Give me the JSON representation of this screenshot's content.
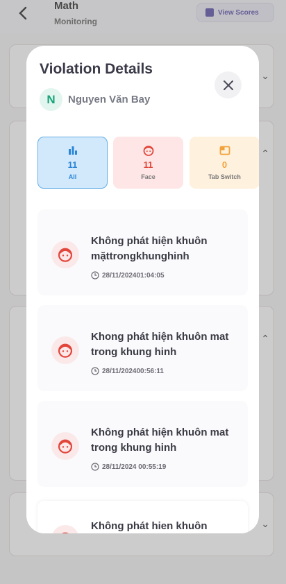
{
  "header": {
    "title": "Math",
    "subtitle": "Monitoring",
    "view_scores": "View Scores"
  },
  "modal": {
    "title": "Violation Details",
    "student_initial": "N",
    "student_name": "Nguyen Văn Bay",
    "tabs": [
      {
        "count": "11",
        "label": "All"
      },
      {
        "count": "11",
        "label": "Face"
      },
      {
        "count": "0",
        "label": "Tab Switch"
      }
    ],
    "violations": [
      {
        "text": "Không phát hiện khuôn mặttrongkhunghinh",
        "time": "28/11/202401:04:05"
      },
      {
        "text": "Khong phát hiện khuôn mat trong khung hinh",
        "time": "28/11/202400:56:11"
      },
      {
        "text": "Không phát hiện khuôn mat trong khung hinh",
        "time": "28/11/2024 00:55:19"
      },
      {
        "text": "Không phát hien khuôn",
        "time": ""
      }
    ]
  },
  "colors": {
    "accent_blue": "#2a86d6",
    "face_red": "#e2453a",
    "tab_orange": "#f1a23a",
    "avatar_green": "#1aa37a"
  }
}
